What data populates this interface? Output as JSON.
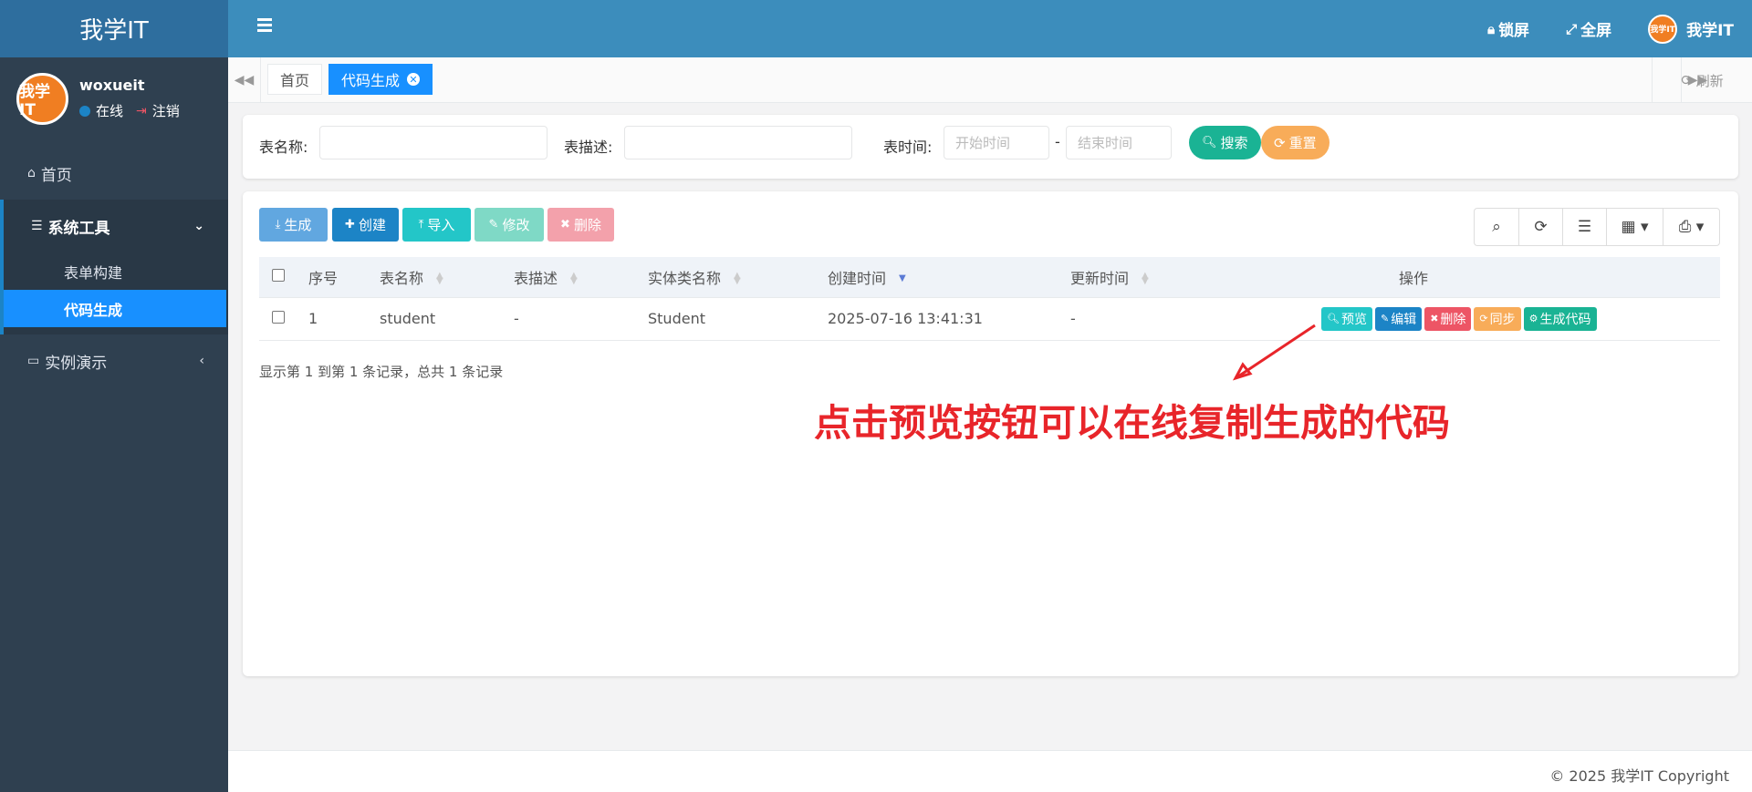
{
  "brand": "我学IT",
  "user": {
    "name": "woxueit",
    "avatar_text": "我学IT",
    "status": "在线",
    "logout": "注销"
  },
  "sidebar": {
    "home": "首页",
    "system_tools": "系统工具",
    "sub_items": [
      "表单构建",
      "代码生成"
    ],
    "demo": "实例演示"
  },
  "header": {
    "lock": "锁屏",
    "fullscreen": "全屏",
    "user": "我学IT",
    "avatar_text": "我学IT"
  },
  "tabs": {
    "home": "首页",
    "active": "代码生成",
    "refresh": "刷新"
  },
  "search": {
    "table_name_label": "表名称:",
    "table_desc_label": "表描述:",
    "time_label": "表时间:",
    "start_placeholder": "开始时间",
    "end_placeholder": "结束时间",
    "separator": "-",
    "search_btn": "搜索",
    "reset_btn": "重置"
  },
  "toolbar": {
    "generate": "生成",
    "create": "创建",
    "import": "导入",
    "edit": "修改",
    "delete": "删除"
  },
  "table": {
    "headers": [
      "序号",
      "表名称",
      "表描述",
      "实体类名称",
      "创建时间",
      "更新时间",
      "操作"
    ],
    "rows": [
      {
        "index": "1",
        "name": "student",
        "desc": "-",
        "entity": "Student",
        "created": "2025-07-16 13:41:31",
        "updated": "-"
      }
    ],
    "ops": [
      "预览",
      "编辑",
      "删除",
      "同步",
      "生成代码"
    ]
  },
  "pagination": "显示第 1 到第 1 条记录，总共 1 条记录",
  "annotation": "点击预览按钮可以在线复制生成的代码",
  "footer": "© 2025 我学IT Copyright",
  "colors": {
    "sidebar": "#2f4050",
    "header": "#3c8dbc",
    "active": "#1890ff",
    "annotation": "#e8252a"
  }
}
